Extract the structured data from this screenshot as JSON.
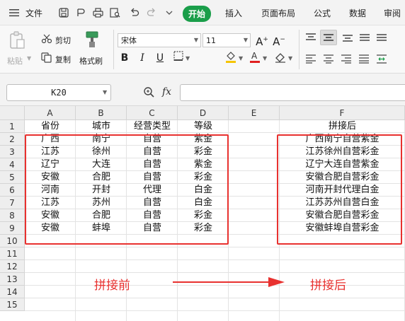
{
  "menubar": {
    "file": "文件",
    "tabs": [
      "开始",
      "插入",
      "页面布局",
      "公式",
      "数据",
      "审阅"
    ]
  },
  "ribbon": {
    "paste": "粘贴",
    "cut": "剪切",
    "copy": "复制",
    "format_painter": "格式刷",
    "font_name": "宋体",
    "font_size": "11",
    "grow_font": "A+",
    "shrink_font": "A-",
    "bold": "B",
    "italic": "I",
    "underline": "U"
  },
  "formula_bar": {
    "cell_ref": "K20",
    "fx": "fx",
    "formula": ""
  },
  "sheet": {
    "columns": [
      "A",
      "B",
      "C",
      "D",
      "E",
      "F"
    ],
    "rows": [
      "1",
      "2",
      "3",
      "4",
      "5",
      "6",
      "7",
      "8",
      "9",
      "10",
      "11",
      "12",
      "13",
      "14",
      "15"
    ],
    "headers": {
      "A": "省份",
      "B": "城市",
      "C": "经营类型",
      "D": "等级",
      "F": "拼接后"
    },
    "data": [
      [
        "广西",
        "南宁",
        "自营",
        "紫金",
        "广西南宁自营紫金"
      ],
      [
        "江苏",
        "徐州",
        "自营",
        "彩金",
        "江苏徐州自营彩金"
      ],
      [
        "辽宁",
        "大连",
        "自营",
        "紫金",
        "辽宁大连自营紫金"
      ],
      [
        "安徽",
        "合肥",
        "自营",
        "彩金",
        "安徽合肥自营彩金"
      ],
      [
        "河南",
        "开封",
        "代理",
        "白金",
        "河南开封代理白金"
      ],
      [
        "江苏",
        "苏州",
        "自营",
        "白金",
        "江苏苏州自营白金"
      ],
      [
        "安徽",
        "合肥",
        "自营",
        "彩金",
        "安徽合肥自营彩金"
      ],
      [
        "安徽",
        "蚌埠",
        "自营",
        "彩金",
        "安徽蚌埠自营彩金"
      ]
    ]
  },
  "annotations": {
    "before": "拼接前",
    "after": "拼接后"
  },
  "colors": {
    "accent": "#1a9e4a",
    "annotation": "#e8312f"
  }
}
